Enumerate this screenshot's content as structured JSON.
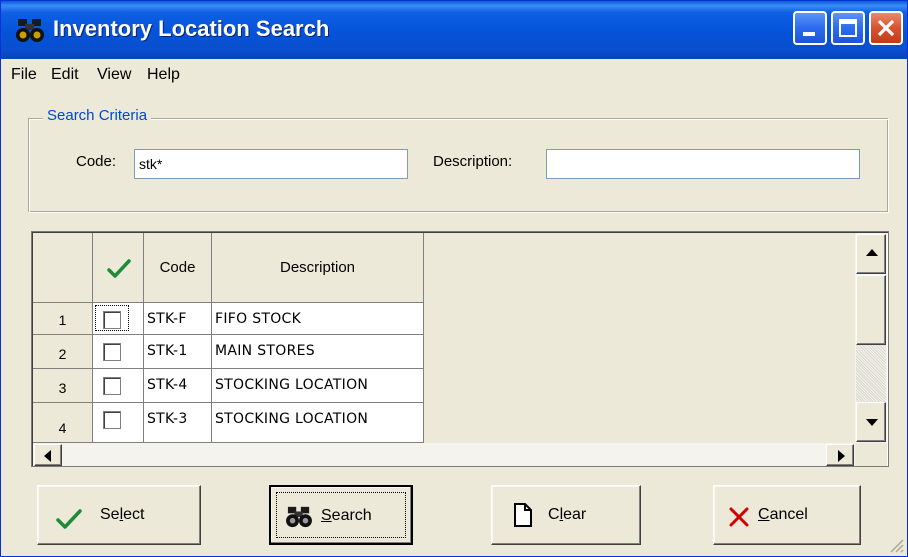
{
  "window": {
    "title": "Inventory Location Search",
    "title_icon": "binoculars-icon",
    "controls": [
      "minimize",
      "maximize",
      "close"
    ]
  },
  "menu": {
    "file": "File",
    "edit": "Edit",
    "view": "View",
    "help": "Help"
  },
  "criteria": {
    "legend": "Search Criteria",
    "code_label": "Code:",
    "code_value": "stk*",
    "description_label": "Description:",
    "description_value": ""
  },
  "grid": {
    "check_header_icon": "checkmark-icon",
    "columns": {
      "code": "Code",
      "description": "Description"
    },
    "rows": [
      {
        "num": "1",
        "checked": false,
        "code": "STK-F",
        "description": "FIFO STOCK"
      },
      {
        "num": "2",
        "checked": false,
        "code": "STK-1",
        "description": "MAIN STORES"
      },
      {
        "num": "3",
        "checked": false,
        "code": "STK-4",
        "description": "STOCKING LOCATION"
      },
      {
        "num": "4",
        "checked": false,
        "code": "STK-3",
        "description": "STOCKING LOCATION"
      }
    ]
  },
  "buttons": {
    "select": {
      "pre": "Se",
      "ul": "l",
      "post": "ect",
      "icon": "checkmark-icon"
    },
    "search": {
      "pre": "",
      "ul": "S",
      "post": "earch",
      "icon": "binoculars-icon"
    },
    "clear": {
      "pre": "C",
      "ul": "l",
      "post": "ear",
      "icon": "document-icon"
    },
    "cancel": {
      "pre": "",
      "ul": "C",
      "post": "ancel",
      "icon": "cross-icon"
    }
  },
  "colors": {
    "titlebar": "#0553d8",
    "legend_text": "#0046d5",
    "check_green": "#1f8a3a",
    "cancel_red": "#d40000"
  }
}
